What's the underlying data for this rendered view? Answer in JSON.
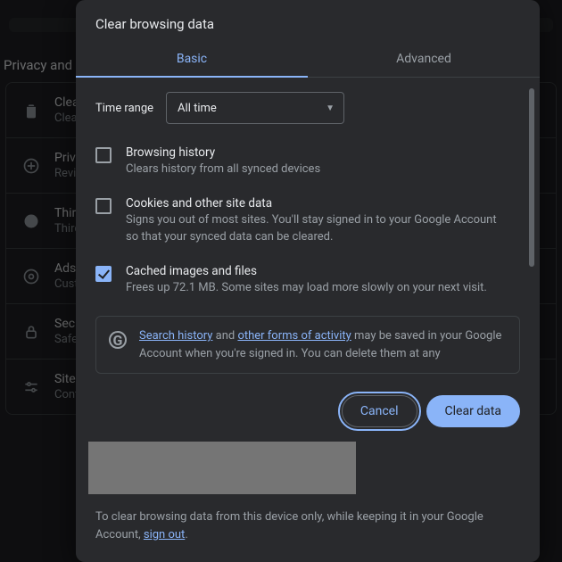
{
  "bg": {
    "heading": "Privacy and security",
    "items": [
      {
        "title": "Clear browsing data",
        "sub": "Clear history, cookies, cache, and more"
      },
      {
        "title": "Privacy Guide",
        "sub": "Review key privacy and security controls"
      },
      {
        "title": "Third-party cookies",
        "sub": "Third-party cookies are blocked in Incognito mode"
      },
      {
        "title": "Ads privacy",
        "sub": "Customize the info used by sites to show you ads"
      },
      {
        "title": "Security",
        "sub": "Safe Browsing (protection from dangerous sites) and other security settings"
      },
      {
        "title": "Site settings",
        "sub": "Controls what information sites can use and show"
      }
    ]
  },
  "dialog": {
    "title": "Clear browsing data",
    "tabs": {
      "basic": "Basic",
      "advanced": "Advanced"
    },
    "time_label": "Time range",
    "time_value": "All time",
    "rows": [
      {
        "title": "Browsing history",
        "sub": "Clears history from all synced devices",
        "checked": false
      },
      {
        "title": "Cookies and other site data",
        "sub": "Signs you out of most sites. You'll stay signed in to your Google Account so that your synced data can be cleared.",
        "checked": false
      },
      {
        "title": "Cached images and files",
        "sub": "Frees up 72.1 MB. Some sites may load more slowly on your next visit.",
        "checked": true
      }
    ],
    "gbox": {
      "link1": "Search history",
      "mid": " and ",
      "link2": "other forms of activity",
      "rest": " may be saved in your Google Account when you're signed in. You can delete them at any"
    },
    "buttons": {
      "cancel": "Cancel",
      "clear": "Clear data"
    },
    "footer": {
      "pre": "To clear browsing data from this device only, while keeping it in your Google Account, ",
      "link": "sign out",
      "post": "."
    }
  }
}
